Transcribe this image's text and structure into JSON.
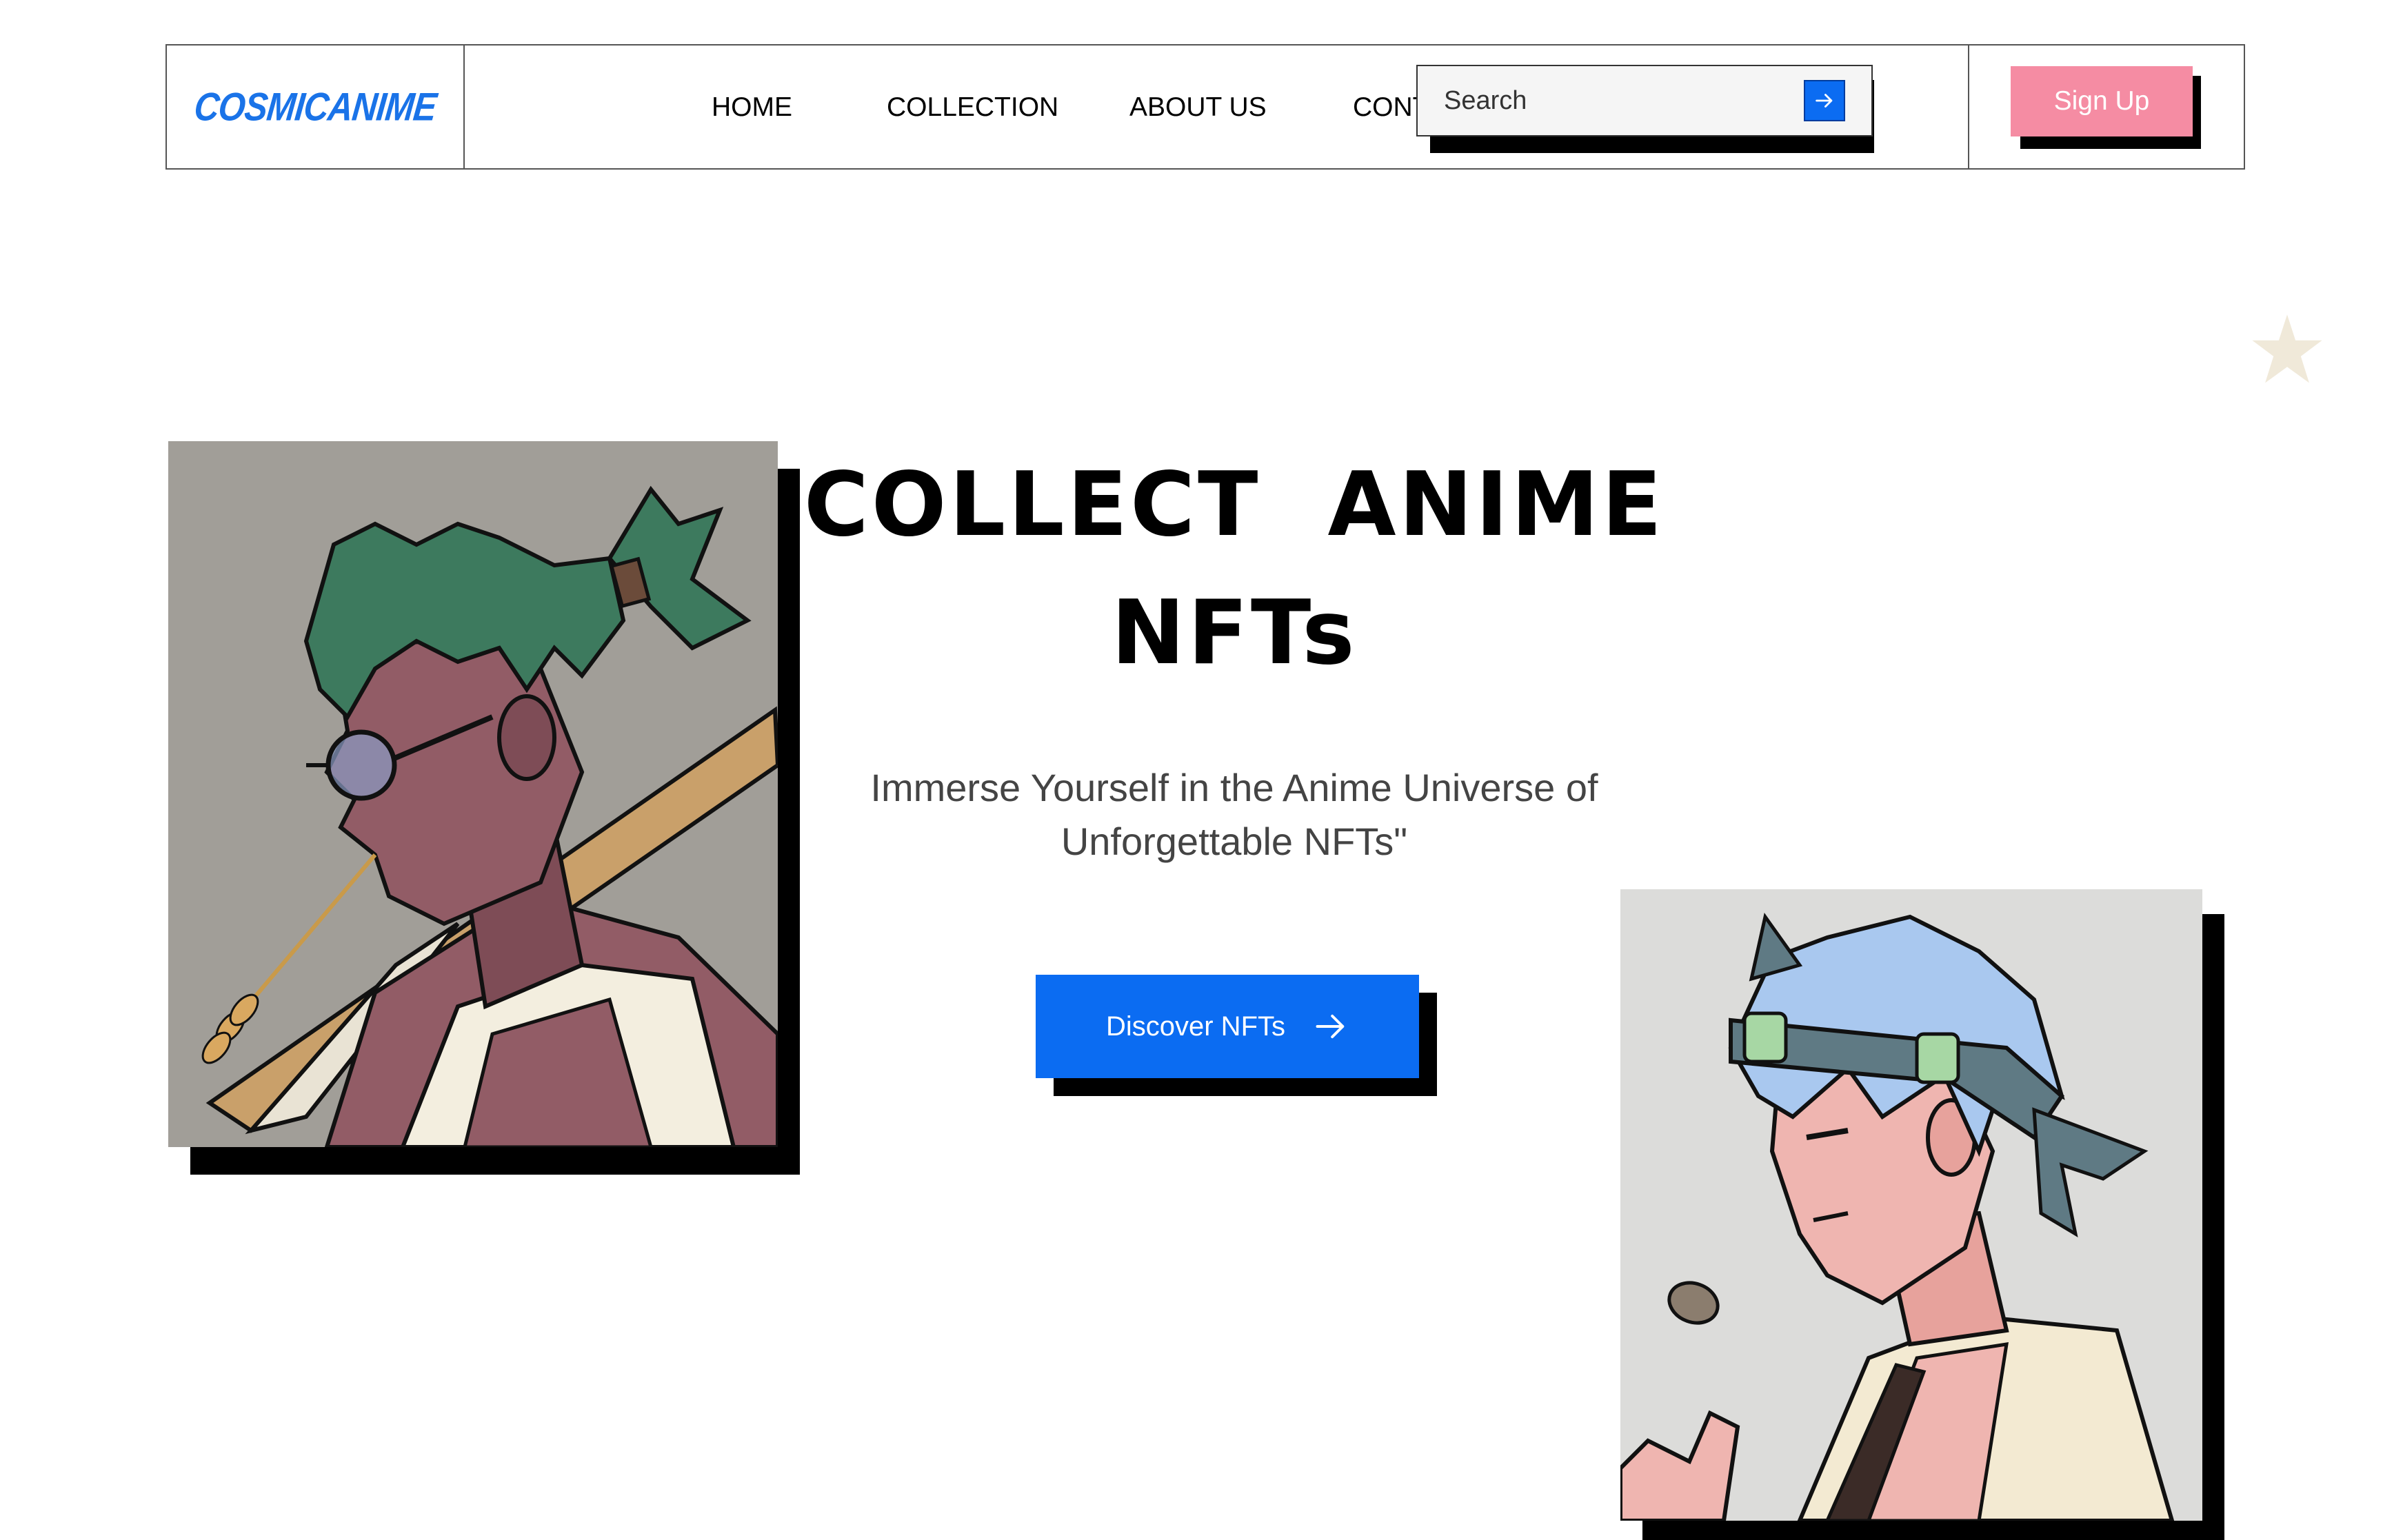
{
  "brand": {
    "logo_text": "COSMICANIME",
    "accent": "#1a73e8"
  },
  "nav": {
    "items": [
      {
        "label": "HOME"
      },
      {
        "label": "COLLECTION"
      },
      {
        "label": "ABOUT US"
      },
      {
        "label": "CONTACT"
      }
    ]
  },
  "search": {
    "placeholder": "Search",
    "value": "",
    "button_icon": "arrow-right-icon"
  },
  "signup": {
    "label": "Sign Up",
    "color": "#f58ca3"
  },
  "hero": {
    "title_line1": "COLLECT  ANIME",
    "title_line2": "NFTs",
    "subtitle_line1": "Immerse Yourself in the Anime Universe of",
    "subtitle_line2": "Unforgettable NFTs\"",
    "cta_label": "Discover NFTs",
    "cta_icon": "arrow-right-icon",
    "cta_color": "#0b6cf2"
  },
  "images": {
    "left": {
      "subject": "anime character with green hair, round glasses and wooden sword"
    },
    "right": {
      "subject": "anime character with blue hair, cat-ear headband and coin"
    }
  },
  "decor": {
    "star_color": "#f0e9d9",
    "triangle_color": "#f58ca3"
  }
}
